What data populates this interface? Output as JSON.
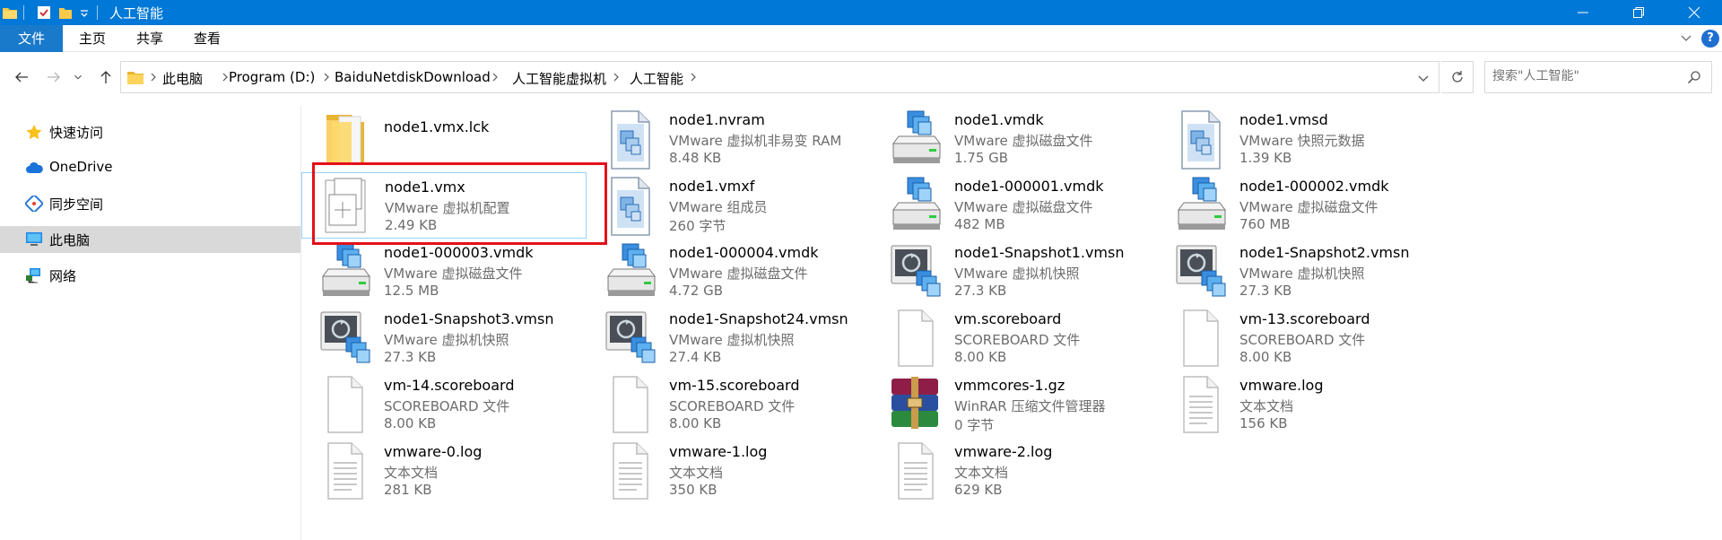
{
  "window": {
    "title": "人工智能",
    "accent": "#0078d7"
  },
  "ribbon": {
    "tabs": [
      "文件",
      "主页",
      "共享",
      "查看"
    ],
    "help": "?"
  },
  "address": {
    "crumbs": [
      "此电脑",
      "Program (D:)",
      "BaiduNetdiskDownload",
      "人工智能虚拟机",
      "人工智能"
    ]
  },
  "search": {
    "placeholder": "搜索\"人工智能\""
  },
  "sidebar": {
    "items": [
      {
        "label": "快速访问",
        "icon": "star-icon"
      },
      {
        "label": "OneDrive",
        "icon": "cloud-icon"
      },
      {
        "label": "同步空间",
        "icon": "sync-icon"
      },
      {
        "label": "此电脑",
        "icon": "computer-icon",
        "selected": true
      },
      {
        "label": "网络",
        "icon": "network-icon"
      }
    ]
  },
  "files": [
    {
      "name": "node1.vmx.lck",
      "type": "",
      "size": "",
      "icon": "folder-icon"
    },
    {
      "name": "node1.nvram",
      "type": "VMware 虚拟机非易变 RAM",
      "size": "8.48 KB",
      "icon": "vmware-doc-icon"
    },
    {
      "name": "node1.vmdk",
      "type": "VMware 虚拟磁盘文件",
      "size": "1.75 GB",
      "icon": "vmware-disk-icon"
    },
    {
      "name": "node1.vmsd",
      "type": "VMware 快照元数据",
      "size": "1.39 KB",
      "icon": "vmware-doc-icon"
    },
    {
      "name": "node1.vmx",
      "type": "VMware 虚拟机配置",
      "size": "2.49 KB",
      "icon": "vmware-config-icon"
    },
    {
      "name": "node1.vmxf",
      "type": "VMware 组成员",
      "size": "260 字节",
      "icon": "vmware-doc-icon"
    },
    {
      "name": "node1-000001.vmdk",
      "type": "VMware 虚拟磁盘文件",
      "size": "482 MB",
      "icon": "vmware-disk-icon"
    },
    {
      "name": "node1-000002.vmdk",
      "type": "VMware 虚拟磁盘文件",
      "size": "760 MB",
      "icon": "vmware-disk-icon"
    },
    {
      "name": "node1-000003.vmdk",
      "type": "VMware 虚拟磁盘文件",
      "size": "12.5 MB",
      "icon": "vmware-disk-icon"
    },
    {
      "name": "node1-000004.vmdk",
      "type": "VMware 虚拟磁盘文件",
      "size": "4.72 GB",
      "icon": "vmware-disk-icon"
    },
    {
      "name": "node1-Snapshot1.vmsn",
      "type": "VMware 虚拟机快照",
      "size": "27.3 KB",
      "icon": "vmware-snapshot-icon"
    },
    {
      "name": "node1-Snapshot2.vmsn",
      "type": "VMware 虚拟机快照",
      "size": "27.3 KB",
      "icon": "vmware-snapshot-icon"
    },
    {
      "name": "node1-Snapshot3.vmsn",
      "type": "VMware 虚拟机快照",
      "size": "27.3 KB",
      "icon": "vmware-snapshot-icon"
    },
    {
      "name": "node1-Snapshot24.vmsn",
      "type": "VMware 虚拟机快照",
      "size": "27.4 KB",
      "icon": "vmware-snapshot-icon"
    },
    {
      "name": "vm.scoreboard",
      "type": "SCOREBOARD 文件",
      "size": "8.00 KB",
      "icon": "blank-file-icon"
    },
    {
      "name": "vm-13.scoreboard",
      "type": "SCOREBOARD 文件",
      "size": "8.00 KB",
      "icon": "blank-file-icon"
    },
    {
      "name": "vm-14.scoreboard",
      "type": "SCOREBOARD 文件",
      "size": "8.00 KB",
      "icon": "blank-file-icon"
    },
    {
      "name": "vm-15.scoreboard",
      "type": "SCOREBOARD 文件",
      "size": "8.00 KB",
      "icon": "blank-file-icon"
    },
    {
      "name": "vmmcores-1.gz",
      "type": "WinRAR 压缩文件管理器",
      "size": "0 字节",
      "icon": "winrar-icon"
    },
    {
      "name": "vmware.log",
      "type": "文本文档",
      "size": "156 KB",
      "icon": "text-file-icon"
    },
    {
      "name": "vmware-0.log",
      "type": "文本文档",
      "size": "281 KB",
      "icon": "text-file-icon"
    },
    {
      "name": "vmware-1.log",
      "type": "文本文档",
      "size": "350 KB",
      "icon": "text-file-icon"
    },
    {
      "name": "vmware-2.log",
      "type": "文本文档",
      "size": "629 KB",
      "icon": "text-file-icon"
    }
  ],
  "highlight_color": "#e3101a"
}
